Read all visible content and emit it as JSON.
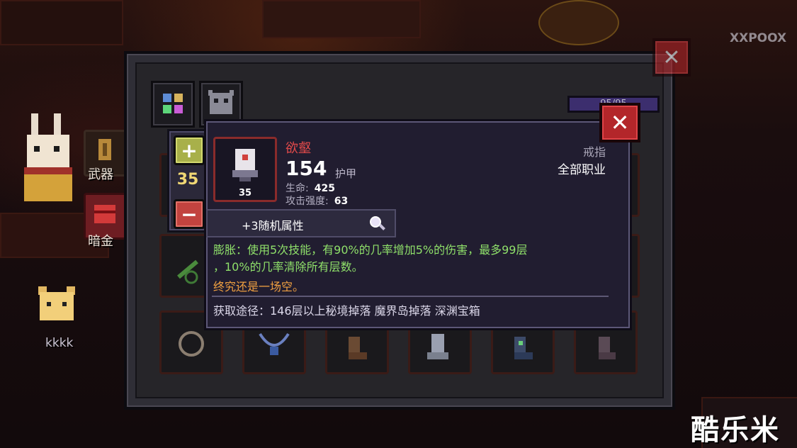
{
  "colors": {
    "rarity_red": "#e24a4a",
    "effect_green": "#8fe06a",
    "flavor_orange": "#f0a041",
    "level_yellow": "#f0d774",
    "close_red": "#b3262a"
  },
  "background": {
    "side_labels": {
      "weapon": "武器",
      "gold": "暗金"
    },
    "player_name": "kkkk",
    "watermark_top": "XXPOOX",
    "watermark_bottom": "酷乐米"
  },
  "panel": {
    "tabs": [
      {
        "name": "equipment-tab",
        "icon": "grid-icon"
      },
      {
        "name": "pet-tab",
        "icon": "monster-icon"
      }
    ],
    "hp_text": "95/95",
    "slots_bottom_row": [
      "ring",
      "necklace",
      "boots",
      "leg-armor",
      "boots-2",
      "boots-3"
    ]
  },
  "stepper": {
    "plus_icon": "plus-icon",
    "level": "35",
    "minus_icon": "minus-icon"
  },
  "tooltip": {
    "item_name": "欲壑",
    "item_level": "35",
    "score": "154",
    "score_type": "护甲",
    "stats": [
      {
        "label": "生命:",
        "value": "425"
      },
      {
        "label": "攻击强度:",
        "value": "63"
      }
    ],
    "slot_type": "戒指",
    "slot_class": "全部职业",
    "random_attr": "+3随机属性",
    "effect_line1": "膨胀：使用5次技能，有90%的几率增加5%的伤害，最多99层",
    "effect_line2": "，10%的几率清除所有层数。",
    "flavor": "终究还是一场空。",
    "source": "获取途径：146层以上秘境掉落 魔界岛掉落 深渊宝箱",
    "close_icon": "close-icon"
  }
}
